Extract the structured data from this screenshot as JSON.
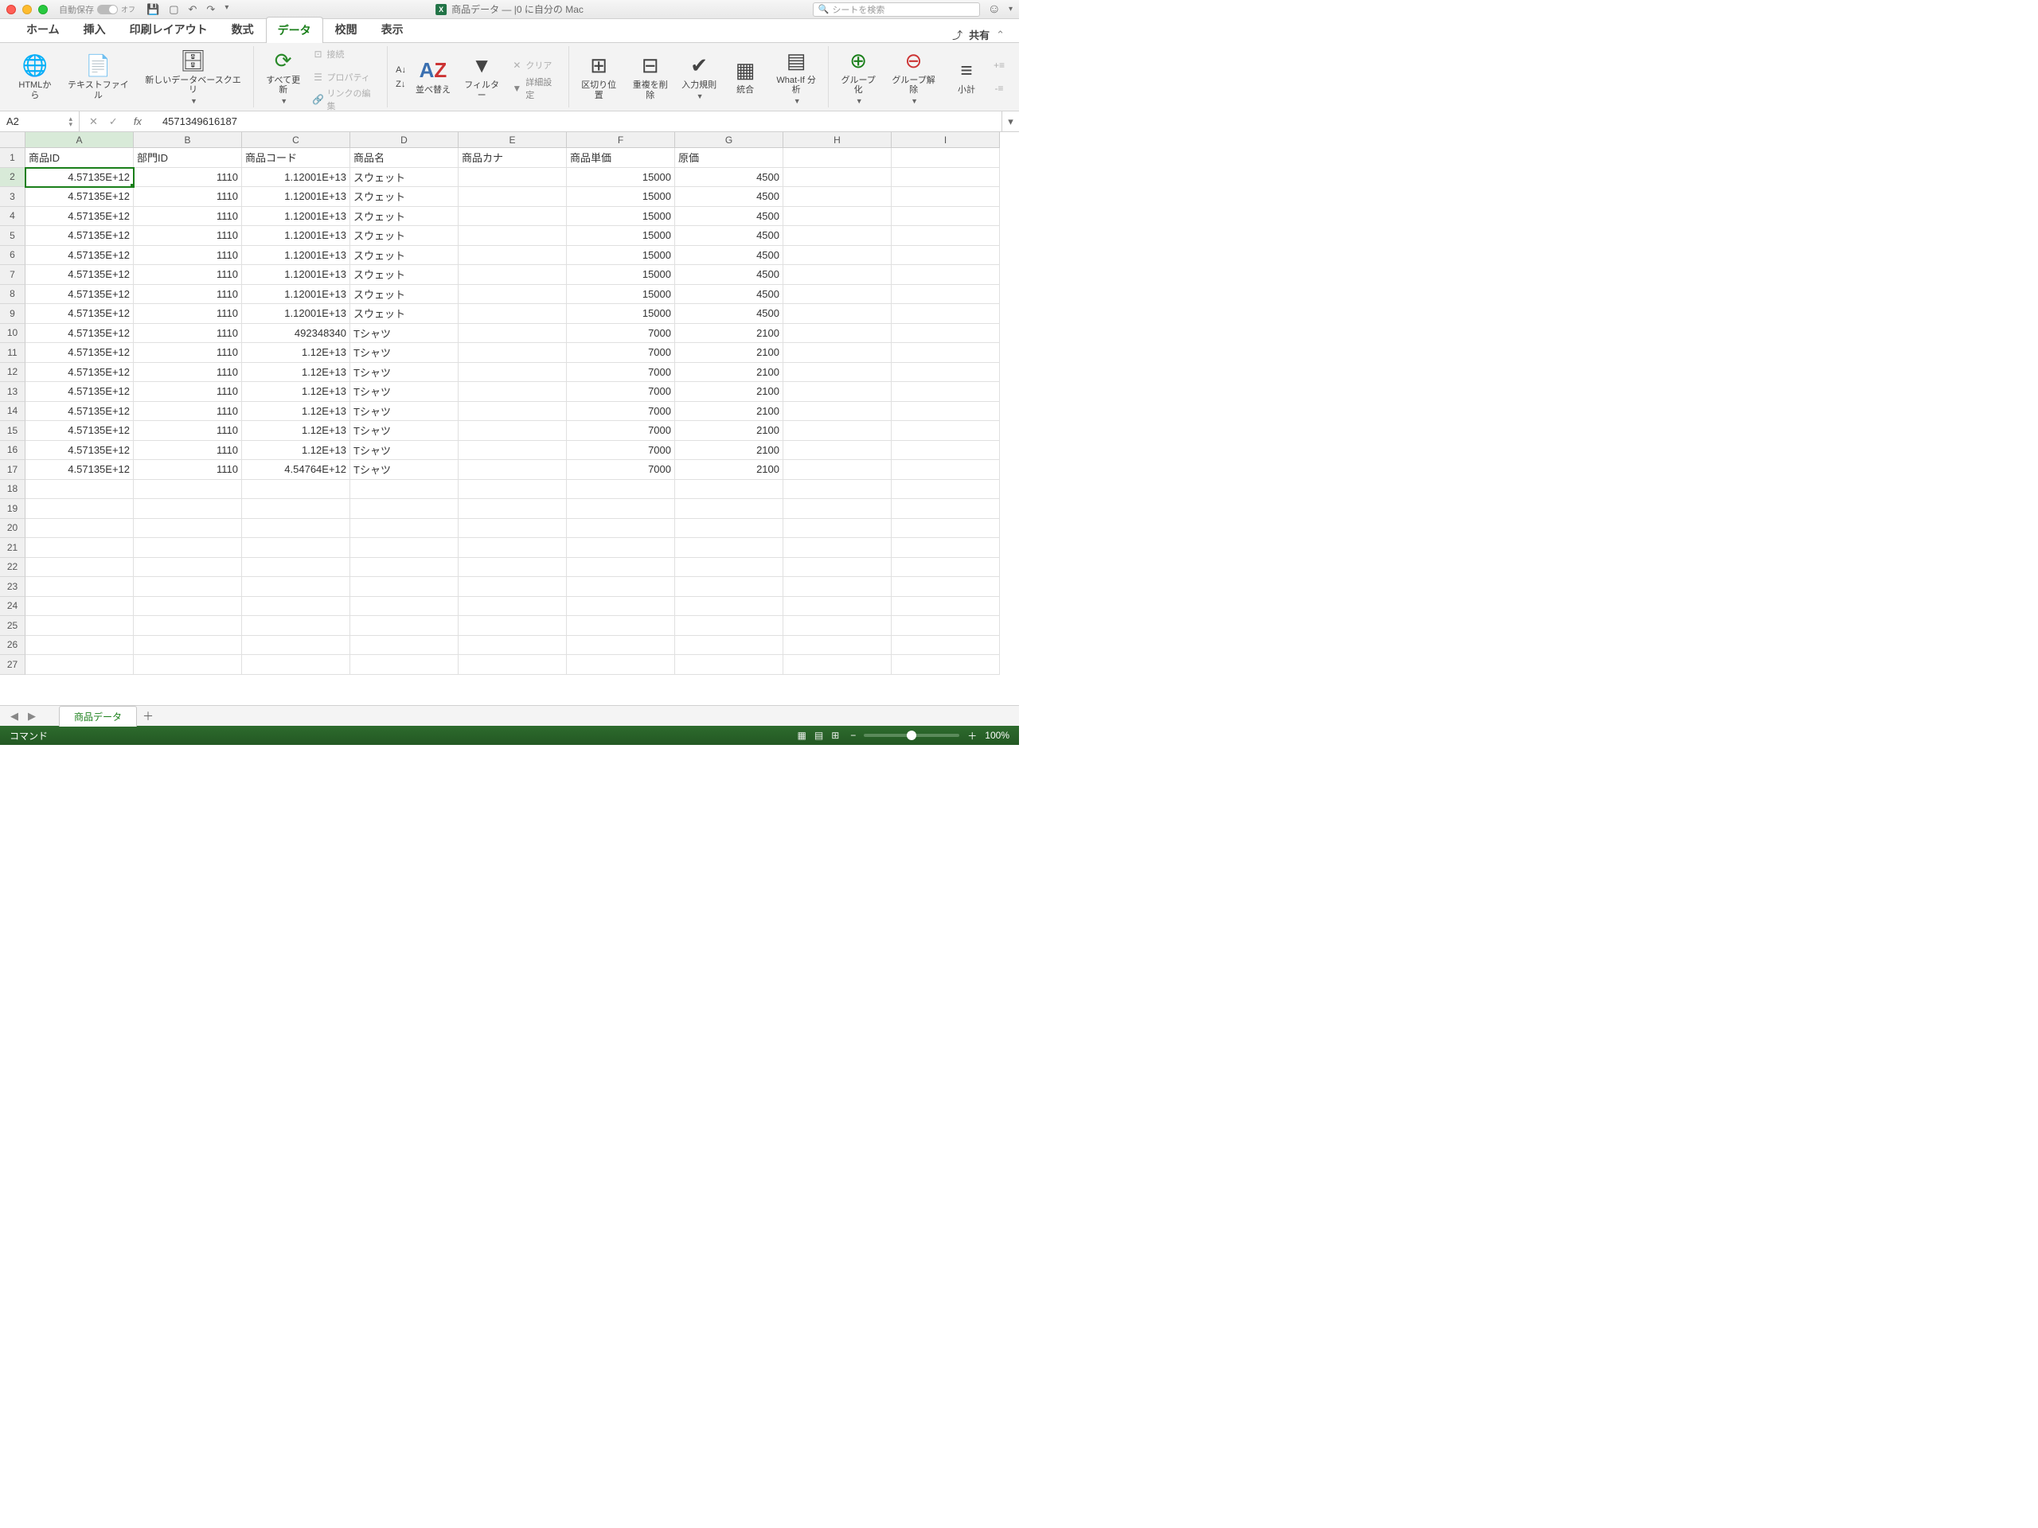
{
  "titlebar": {
    "autosave_label": "自動保存",
    "autosave_state": "オフ",
    "doc_title": "商品データ — |0 に自分の Mac",
    "search_placeholder": "シートを検索"
  },
  "tabs": {
    "items": [
      "ホーム",
      "挿入",
      "印刷レイアウト",
      "数式",
      "データ",
      "校閲",
      "表示"
    ],
    "active_index": 4,
    "share": "共有"
  },
  "ribbon": {
    "html_from": "HTMLから",
    "text_file": "テキストファイル",
    "new_db_query": "新しいデータベースクエリ",
    "refresh_all": "すべて更新",
    "connections": "接続",
    "properties": "プロパティ",
    "edit_links": "リンクの編集",
    "sort_asc": "A→Z",
    "sort_desc": "Z→A",
    "sort": "並べ替え",
    "filter": "フィルター",
    "clear": "クリア",
    "advanced": "詳細設定",
    "text_to_cols": "区切り位置",
    "remove_dup": "重複を削除",
    "data_val": "入力規則",
    "consolidate": "統合",
    "whatif": "What-If 分析",
    "group": "グループ化",
    "ungroup": "グループ解除",
    "subtotal": "小計"
  },
  "formula_bar": {
    "cell_ref": "A2",
    "value": "4571349616187"
  },
  "columns": [
    {
      "letter": "A",
      "width": 136
    },
    {
      "letter": "B",
      "width": 136
    },
    {
      "letter": "C",
      "width": 136
    },
    {
      "letter": "D",
      "width": 136
    },
    {
      "letter": "E",
      "width": 136
    },
    {
      "letter": "F",
      "width": 136
    },
    {
      "letter": "G",
      "width": 136
    },
    {
      "letter": "H",
      "width": 136
    },
    {
      "letter": "I",
      "width": 136
    }
  ],
  "headers": [
    "商品ID",
    "部門ID",
    "商品コード",
    "商品名",
    "商品カナ",
    "商品単価",
    "原価",
    "",
    ""
  ],
  "rows": [
    [
      "4.57135E+12",
      "1110",
      "1.12001E+13",
      "スウェット",
      "",
      "15000",
      "4500",
      "",
      ""
    ],
    [
      "4.57135E+12",
      "1110",
      "1.12001E+13",
      "スウェット",
      "",
      "15000",
      "4500",
      "",
      ""
    ],
    [
      "4.57135E+12",
      "1110",
      "1.12001E+13",
      "スウェット",
      "",
      "15000",
      "4500",
      "",
      ""
    ],
    [
      "4.57135E+12",
      "1110",
      "1.12001E+13",
      "スウェット",
      "",
      "15000",
      "4500",
      "",
      ""
    ],
    [
      "4.57135E+12",
      "1110",
      "1.12001E+13",
      "スウェット",
      "",
      "15000",
      "4500",
      "",
      ""
    ],
    [
      "4.57135E+12",
      "1110",
      "1.12001E+13",
      "スウェット",
      "",
      "15000",
      "4500",
      "",
      ""
    ],
    [
      "4.57135E+12",
      "1110",
      "1.12001E+13",
      "スウェット",
      "",
      "15000",
      "4500",
      "",
      ""
    ],
    [
      "4.57135E+12",
      "1110",
      "1.12001E+13",
      "スウェット",
      "",
      "15000",
      "4500",
      "",
      ""
    ],
    [
      "4.57135E+12",
      "1110",
      "492348340",
      "Tシャツ",
      "",
      "7000",
      "2100",
      "",
      ""
    ],
    [
      "4.57135E+12",
      "1110",
      "1.12E+13",
      "Tシャツ",
      "",
      "7000",
      "2100",
      "",
      ""
    ],
    [
      "4.57135E+12",
      "1110",
      "1.12E+13",
      "Tシャツ",
      "",
      "7000",
      "2100",
      "",
      ""
    ],
    [
      "4.57135E+12",
      "1110",
      "1.12E+13",
      "Tシャツ",
      "",
      "7000",
      "2100",
      "",
      ""
    ],
    [
      "4.57135E+12",
      "1110",
      "1.12E+13",
      "Tシャツ",
      "",
      "7000",
      "2100",
      "",
      ""
    ],
    [
      "4.57135E+12",
      "1110",
      "1.12E+13",
      "Tシャツ",
      "",
      "7000",
      "2100",
      "",
      ""
    ],
    [
      "4.57135E+12",
      "1110",
      "1.12E+13",
      "Tシャツ",
      "",
      "7000",
      "2100",
      "",
      ""
    ],
    [
      "4.57135E+12",
      "1110",
      "4.54764E+12",
      "Tシャツ",
      "",
      "7000",
      "2100",
      "",
      ""
    ]
  ],
  "total_rows": 27,
  "selected": {
    "row": 2,
    "col": 0
  },
  "sheet_tab": "商品データ",
  "status": {
    "mode": "コマンド",
    "zoom": "100%"
  }
}
